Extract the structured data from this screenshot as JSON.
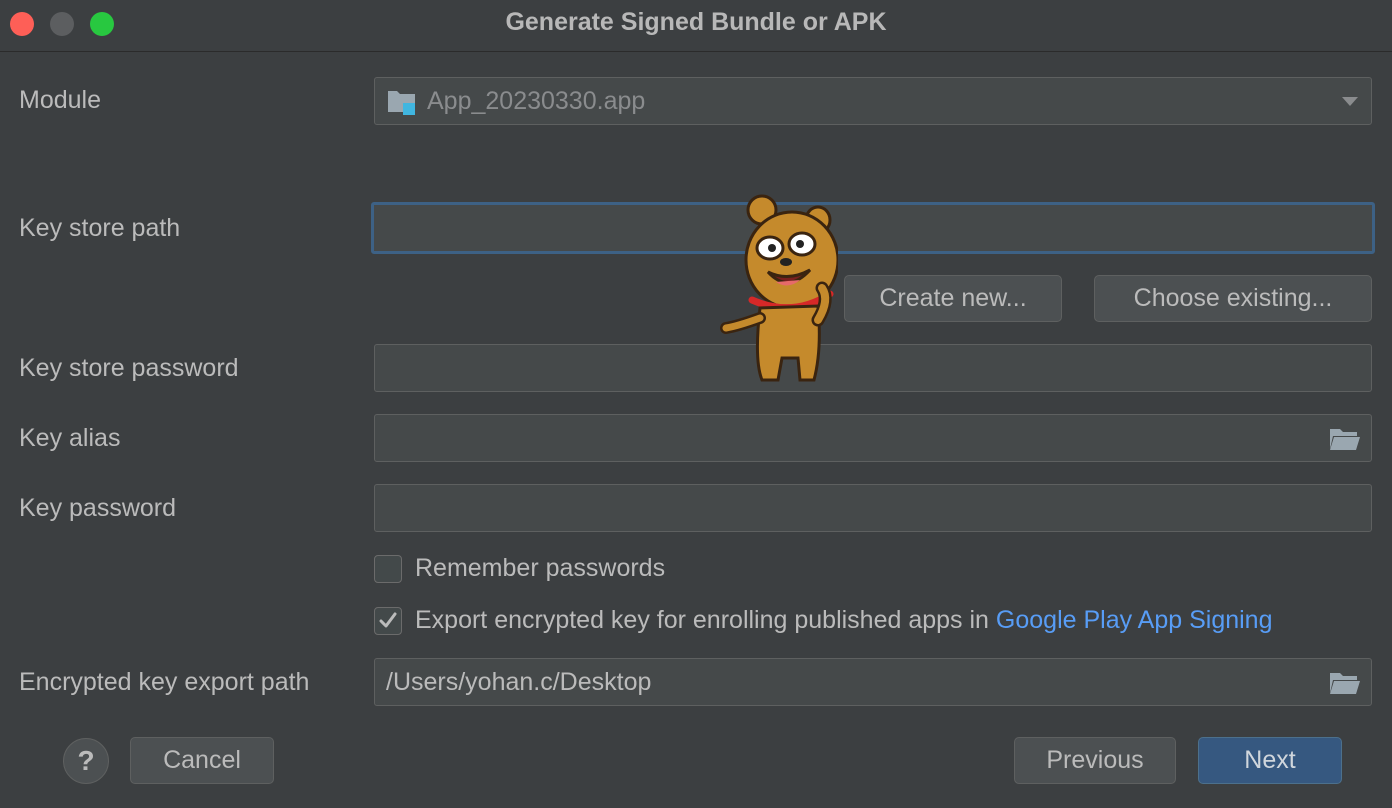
{
  "window": {
    "title": "Generate Signed Bundle or APK"
  },
  "form": {
    "module_label": "Module",
    "module_value": "App_20230330.app",
    "key_store_path_label": "Key store path",
    "key_store_path_value": "",
    "create_new_label": "Create new...",
    "choose_existing_label": "Choose existing...",
    "key_store_password_label": "Key store password",
    "key_alias_label": "Key alias",
    "key_password_label": "Key password",
    "remember_passwords_label": "Remember passwords",
    "remember_passwords_checked": false,
    "export_key_label": "Export encrypted key for enrolling published apps in",
    "export_key_link": "Google Play App Signing",
    "export_key_checked": true,
    "export_path_label": "Encrypted key export path",
    "export_path_value": "/Users/yohan.c/Desktop"
  },
  "footer": {
    "help_label": "?",
    "cancel_label": "Cancel",
    "previous_label": "Previous",
    "next_label": "Next"
  },
  "icons": {
    "module": "module-folder-icon",
    "dropdown": "chevron-down-icon",
    "folder": "folder-open-icon",
    "check": "checkmark-icon",
    "sticker": "dog-sticker-icon"
  },
  "colors": {
    "background": "#3c3f41",
    "field": "#45494a",
    "focus_border": "#3d6185",
    "primary_button": "#365880",
    "link": "#589df6"
  }
}
